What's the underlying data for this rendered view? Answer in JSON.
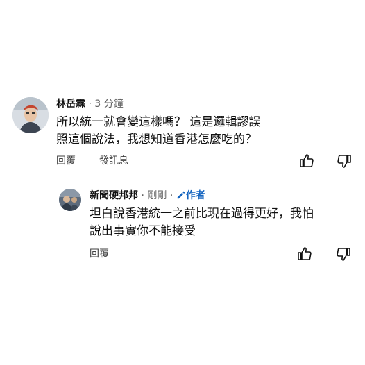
{
  "comment": {
    "author": "林岳霖",
    "separator": "·",
    "time": "3 分鐘",
    "lines": [
      "所以統一就會變這樣嗎？ 這是邏輯謬誤",
      "照這個說法，我想知道香港怎麼吃的？"
    ],
    "reply_label": "回覆",
    "message_label": "發訊息",
    "like_icon": "thumb-up-icon",
    "dislike_icon": "thumb-down-icon"
  },
  "reply": {
    "author": "新聞硬邦邦",
    "separator": "·",
    "time": "剛剛",
    "separator2": "·",
    "badge_icon": "pencil-icon",
    "badge_label": "作者",
    "lines": [
      "坦白說香港統一之前比現在過得更好，我怕",
      "說出事實你不能接受"
    ],
    "reply_label": "回覆",
    "like_icon": "thumb-up-icon",
    "dislike_icon": "thumb-down-icon"
  },
  "colors": {
    "author_badge": "#1565c0",
    "secondary_text": "#606060"
  }
}
